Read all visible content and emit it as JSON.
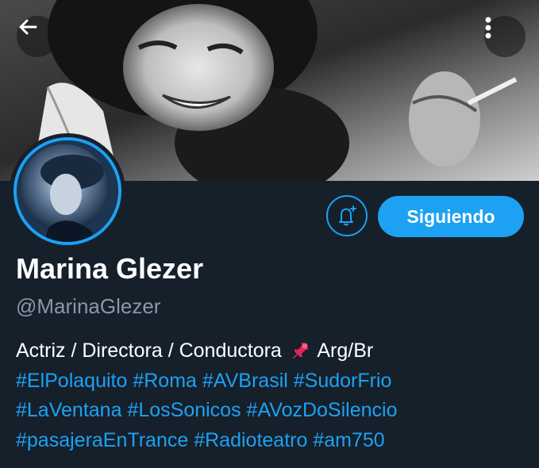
{
  "header": {
    "back_icon": "arrow-left-icon",
    "more_icon": "more-vertical-icon"
  },
  "profile": {
    "display_name": "Marina Glezer",
    "handle": "@MarinaGlezer",
    "follow_button_label": "Siguiendo",
    "notify_icon": "bell-plus-icon",
    "bio": {
      "line1_text": "Actriz / Directora / Conductora",
      "line1_pin_icon": "pushpin-icon",
      "line1_suffix": "Arg/Br",
      "hashtags_line2": [
        "#ElPolaquito",
        "#Roma",
        "#AVBrasil",
        "#SudorFrio"
      ],
      "hashtags_line3": [
        "#LaVentana",
        "#LosSonicos",
        "#AVozDoSilencio"
      ],
      "hashtags_line4": [
        "#pasajeraEnTrance",
        "#Radioteatro",
        "#am750"
      ]
    }
  },
  "colors": {
    "background": "#15202b",
    "accent": "#1da1f2",
    "text_primary": "#ffffff",
    "text_secondary": "#8899a6"
  }
}
